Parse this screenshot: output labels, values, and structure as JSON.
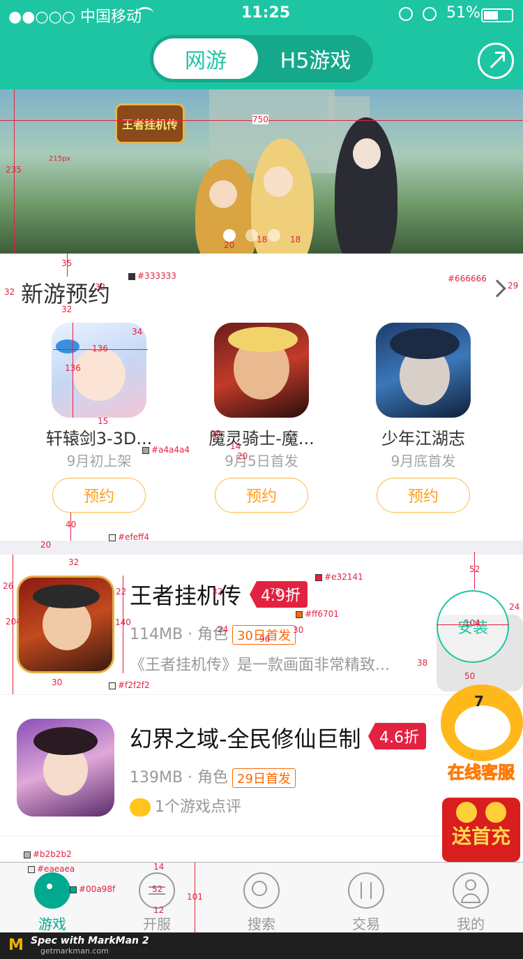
{
  "status_bar": {
    "carrier": "●●○○○ 中国移动",
    "time": "11:25",
    "battery": "51%"
  },
  "header": {
    "tabs": [
      "网游",
      "H5游戏"
    ],
    "active_tab": "网游"
  },
  "banner": {
    "title": "王者挂机传",
    "dots": 3,
    "active_dot": 0
  },
  "preorder": {
    "title": "新游预约",
    "games": [
      {
        "name": "轩辕剑3-3D...",
        "date": "9月初上架",
        "button": "预约"
      },
      {
        "name": "魔灵骑士-魔...",
        "date": "9月5日首发",
        "button": "预约"
      },
      {
        "name": "少年江湖志",
        "date": "9月底首发",
        "button": "预约"
      }
    ]
  },
  "games": [
    {
      "name": "王者挂机传",
      "rating": "4.9折",
      "size": "114MB · 角色",
      "badge": "30日首发",
      "desc": "《王者挂机传》是一款画面非常精致...",
      "action": "安装"
    },
    {
      "name": "幻界之域-全民修仙巨制",
      "rating": "4.6折",
      "size": "139MB · 角色",
      "badge": "29日首发",
      "comments": "1个游戏点评"
    }
  ],
  "floating": {
    "service": "在线客服",
    "recharge": "送首充"
  },
  "tabbar": {
    "active": "游戏",
    "tabs": [
      "游戏",
      "开服",
      "搜索",
      "交易",
      "我的"
    ]
  },
  "footer": {
    "markman": "Spec with MarkMan 2",
    "site": "getmarkman.com"
  },
  "colors": {
    "brand": "#1dc5a3",
    "title_text": "#333333",
    "secondary_text": "#a4a4a4",
    "section_gap": "#efeff4",
    "divider": "#f2f2f2",
    "rating_red": "#e32141",
    "badge_orange": "#ff6701",
    "tab_active": "#00a98f",
    "tab_border": "#b2b2b2",
    "tabbar_bg": "#eaeaea",
    "chevron": "#666666"
  },
  "annotations": {
    "banner_width": "750",
    "banner_height": "235",
    "banner_note": "215px",
    "dot_a": "20",
    "dot_b": "18",
    "dot_c": "18",
    "sec_top": "35",
    "sec_left": "32",
    "sec_font": "32",
    "sec_color": "#333333",
    "arrow_color": "#666666",
    "arrow_size": "29",
    "icon_top": "32",
    "icon_w": "136",
    "icon_h": "136",
    "icon_r": "34",
    "name_gap": "15",
    "date_color": "#a4a4a4",
    "name_font": "24",
    "date_gap": "14",
    "date_font": "20",
    "btn_gap": "40",
    "gap_h": "20",
    "gap_color": "#efeff4",
    "item_top": "32",
    "item_radius": "26",
    "item_h": "204",
    "title_gap": "22",
    "icon_size": "140",
    "title_font": "32",
    "rating_color": "#e32141",
    "rating_w": "78",
    "rating_h": "41",
    "badge_color": "#ff6701",
    "badge_h": "24",
    "badge_w": "96",
    "badge_w2": "30",
    "install_top": "52",
    "install_size": "104",
    "install_right": "24",
    "install_bottom": "50",
    "desc_right": "38",
    "icon_bottom": "30",
    "divider_color": "#f2f2f2",
    "tab_border": "#b2b2b2",
    "tab_bg": "#eaeaea",
    "tab_top": "14",
    "tab_icon": "52",
    "tab_gap": "12",
    "tab_h": "101",
    "tab_color": "#00a98f"
  }
}
